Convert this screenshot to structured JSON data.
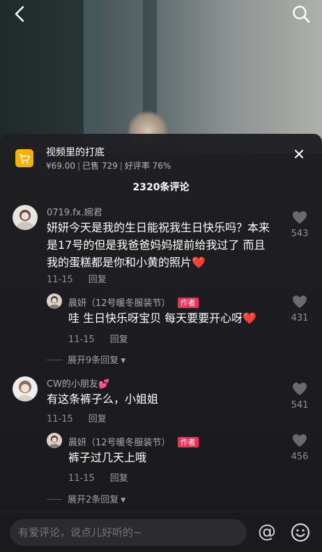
{
  "product": {
    "title": "视频里的打底",
    "price": "¥69.00",
    "sold": "已售 729",
    "rating": "好评率 76%"
  },
  "comment_count": "2320条评论",
  "comments": [
    {
      "user": "0719.fx.婉君",
      "text": "妍妍今天是我的生日能祝我生日快乐吗？本来是17号的但是我爸爸妈妈提前给我过了 而且我的蛋糕都是你和小黄的照片",
      "emoji": "❤️",
      "date": "11-15",
      "reply_label": "回复",
      "likes": "543",
      "reply": {
        "user": "晨妍（12号暖冬服装节）",
        "badge": "作者",
        "text": "哇 生日快乐呀宝贝 每天要要开心呀",
        "emoji": "❤️",
        "date": "11-15",
        "reply_label": "回复",
        "likes": "431"
      },
      "expand": "展开9条回复"
    },
    {
      "user": "CW的小朋友",
      "user_emoji": "💕",
      "text": "有这条裤子么，小姐姐",
      "date": "11-15",
      "reply_label": "回复",
      "likes": "541",
      "reply": {
        "user": "晨妍（12号暖冬服装节）",
        "badge": "作者",
        "text": "裤子过几天上哦",
        "date": "11-15",
        "reply_label": "回复",
        "likes": "456"
      },
      "expand": "展开2条回复"
    }
  ],
  "input": {
    "placeholder": "有爱评论，说点儿好听的~"
  },
  "icons": {
    "back": "chevron-left-icon",
    "search": "search-icon",
    "close": "close-icon",
    "cart": "cart-icon",
    "heart": "heart-icon",
    "at": "at-icon",
    "emoji": "emoji-icon"
  },
  "colors": {
    "accent": "#fe2c55",
    "cart": "#f5b301"
  }
}
